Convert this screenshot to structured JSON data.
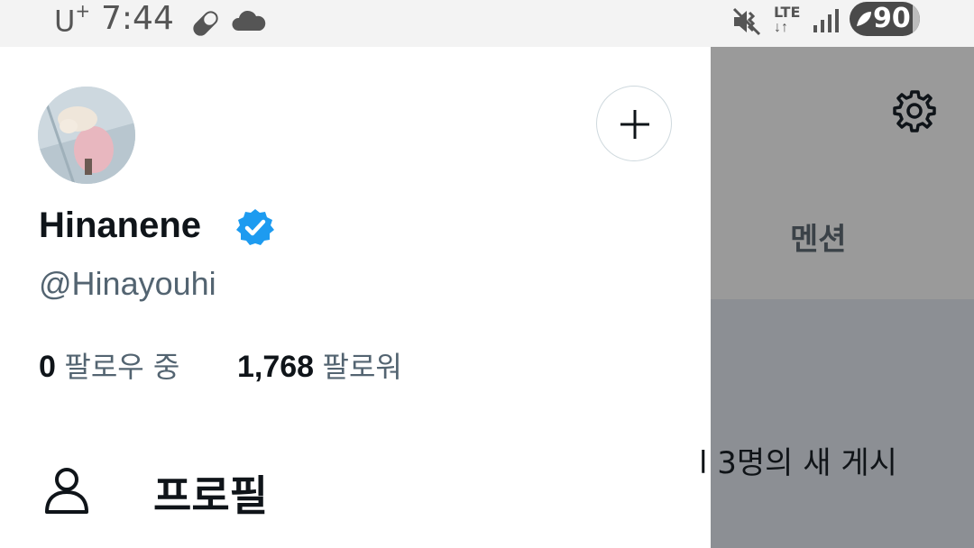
{
  "status_bar": {
    "carrier": "U",
    "carrier_sup": "+",
    "time": "7:44",
    "network": "LTE",
    "battery": "90"
  },
  "drawer": {
    "display_name": "Hinanene",
    "handle": "@Hinayouhi",
    "following_count": "0",
    "following_label": "팔로우 중",
    "followers_count": "1,768",
    "followers_label": "팔로워",
    "menu": [
      {
        "label": "프로필",
        "icon": "person-icon"
      }
    ]
  },
  "background": {
    "tab_label": "멘션",
    "notification_text": "l 3명의 새 게시"
  },
  "colors": {
    "verified": "#1d9bf0",
    "secondary_text": "#536471",
    "overlay": "#9a9a9a"
  }
}
